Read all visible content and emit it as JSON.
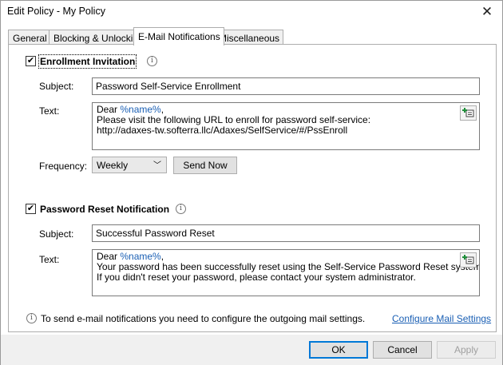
{
  "window": {
    "title": "Edit Policy - My Policy",
    "close_glyph": "✕"
  },
  "tabs": [
    {
      "label": "General",
      "active": false
    },
    {
      "label": "Blocking & Unlocking",
      "active": false
    },
    {
      "label": "E-Mail Notifications",
      "active": true
    },
    {
      "label": "Miscellaneous",
      "active": false
    }
  ],
  "enrollment": {
    "checked": true,
    "label": "Enrollment Invitation",
    "subject_label": "Subject:",
    "subject": "Password Self-Service Enrollment",
    "text_label": "Text:",
    "text_lines": {
      "l1_prefix": "Dear ",
      "l1_var": "%name%",
      "l1_suffix": ",",
      "l2": "Please visit the following URL to enroll for password self-service:",
      "l3": "http://adaxes-tw.softerra.llc/Adaxes/SelfService/#/PssEnroll"
    },
    "frequency_label": "Frequency:",
    "frequency_value": "Weekly",
    "send_now_label": "Send Now"
  },
  "reset": {
    "checked": true,
    "label": "Password Reset Notification",
    "subject_label": "Subject:",
    "subject": "Successful Password Reset",
    "text_label": "Text:",
    "text_lines": {
      "l1_prefix": "Dear ",
      "l1_var": "%name%",
      "l1_suffix": ",",
      "l2": "Your password has been successfully reset using the Self-Service Password Reset system.",
      "l3": "If you didn't reset your password, please contact your system administrator."
    }
  },
  "info_note": "To send e-mail notifications you need to configure the outgoing mail settings.",
  "configure_link": "Configure Mail Settings",
  "buttons": {
    "ok": "OK",
    "cancel": "Cancel",
    "apply": "Apply"
  },
  "colors": {
    "accent": "#0078d7",
    "link": "#1a5fb4"
  }
}
